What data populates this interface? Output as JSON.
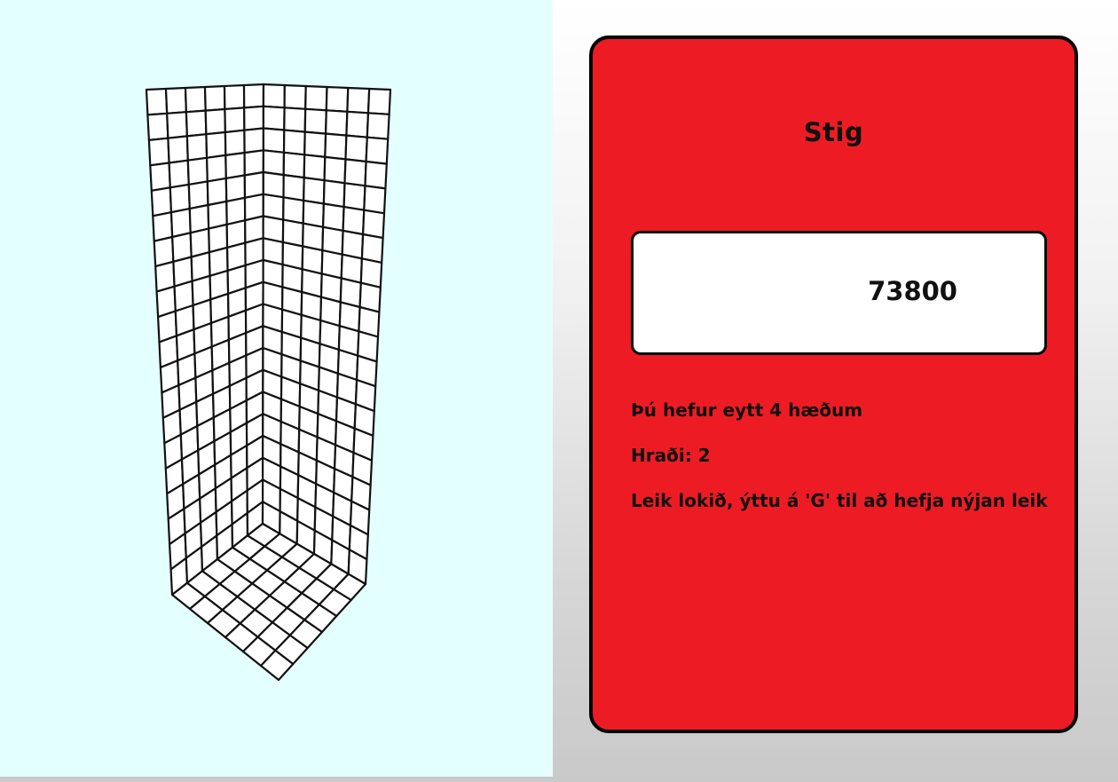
{
  "scoreboard": {
    "title": "Stig",
    "score": "73800",
    "rows_cleared": "Þú hefur eytt 4 hæðum",
    "speed": "Hraði: 2",
    "game_over_message": "Leik lokið, ýttu á 'G' til að hefja nýjan leik"
  },
  "well": {
    "columns_per_face": 6,
    "rows": 20,
    "colors": {
      "background": "#e4ffff",
      "cell_fill": "#ffffff",
      "cell_stroke": "#111111"
    }
  },
  "colors": {
    "panel": "#ed1c24",
    "score_box": "#ffffff",
    "text": "#111111"
  }
}
